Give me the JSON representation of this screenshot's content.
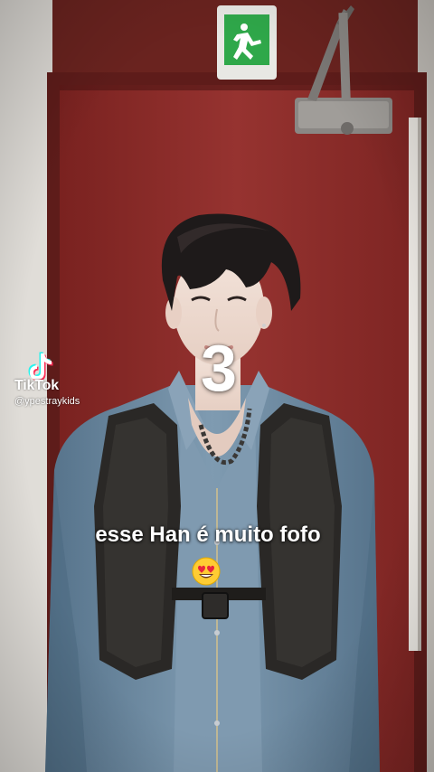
{
  "overlay": {
    "countdown": "3",
    "caption": "esse Han é muito fofo",
    "caption_emoji": "heart-eyes-emoji"
  },
  "watermark": {
    "logo_icon": "tiktok-note-icon",
    "name": "TikTok",
    "handle": "@ypestraykids"
  },
  "colors": {
    "door": "#8b2a27",
    "wall": "#d9d6d2",
    "exit_sign": "#2fa84a",
    "denim": "#6b8aa3",
    "vest": "#2a2826",
    "tiktok_cyan": "#25f4ee",
    "tiktok_red": "#fe2c55"
  }
}
